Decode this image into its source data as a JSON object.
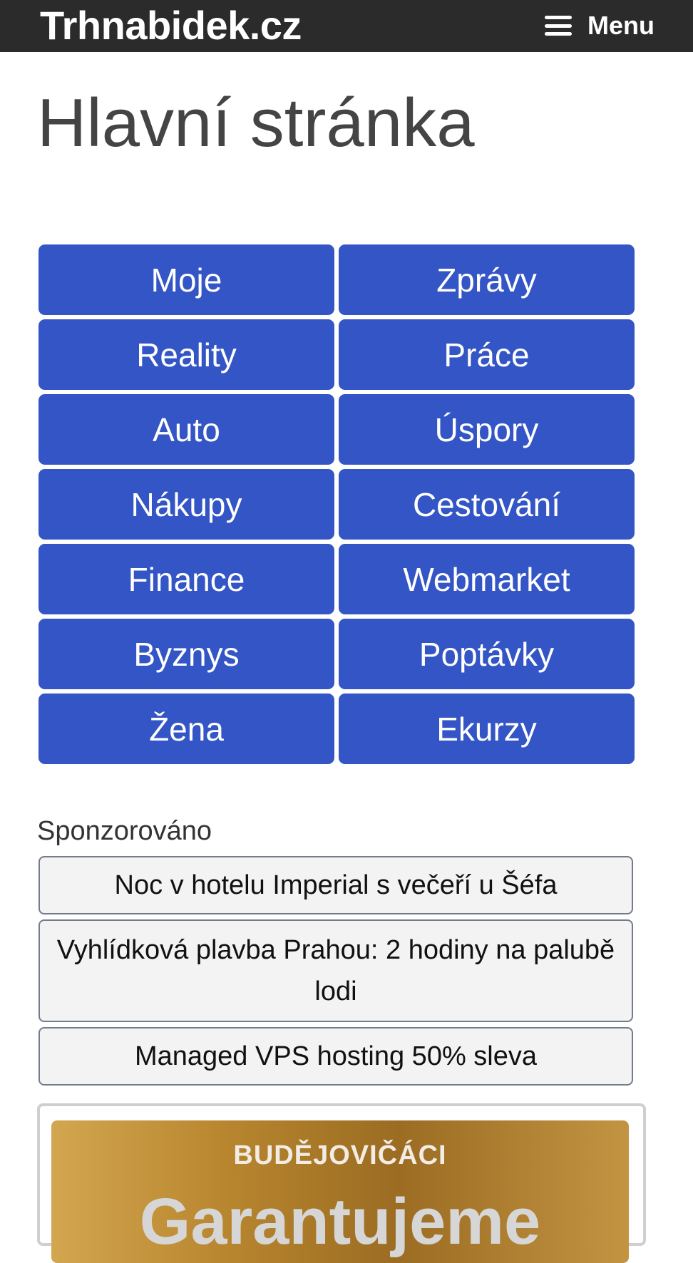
{
  "header": {
    "brand": "Trhnabidek.cz",
    "menu_label": "Menu"
  },
  "page": {
    "title": "Hlavní stránka"
  },
  "categories": [
    "Moje",
    "Zprávy",
    "Reality",
    "Práce",
    "Auto",
    "Úspory",
    "Nákupy",
    "Cestování",
    "Finance",
    "Webmarket",
    "Byznys",
    "Poptávky",
    "Žena",
    "Ekurzy"
  ],
  "sponsored": {
    "label": "Sponzorováno",
    "ads": [
      "Noc v hotelu Imperial s večeří u Šéfa",
      "Vyhlídková plavba Prahou: 2 hodiny na palubě lodi",
      "Managed VPS hosting 50% sleva"
    ]
  },
  "banner": {
    "top_text": "BUDĚJOVIČÁCI",
    "big_text": "Garantujeme"
  },
  "colors": {
    "header_bg": "#2b2b2b",
    "category_button": "#3355c5",
    "ad_button_bg": "#f3f3f3"
  }
}
